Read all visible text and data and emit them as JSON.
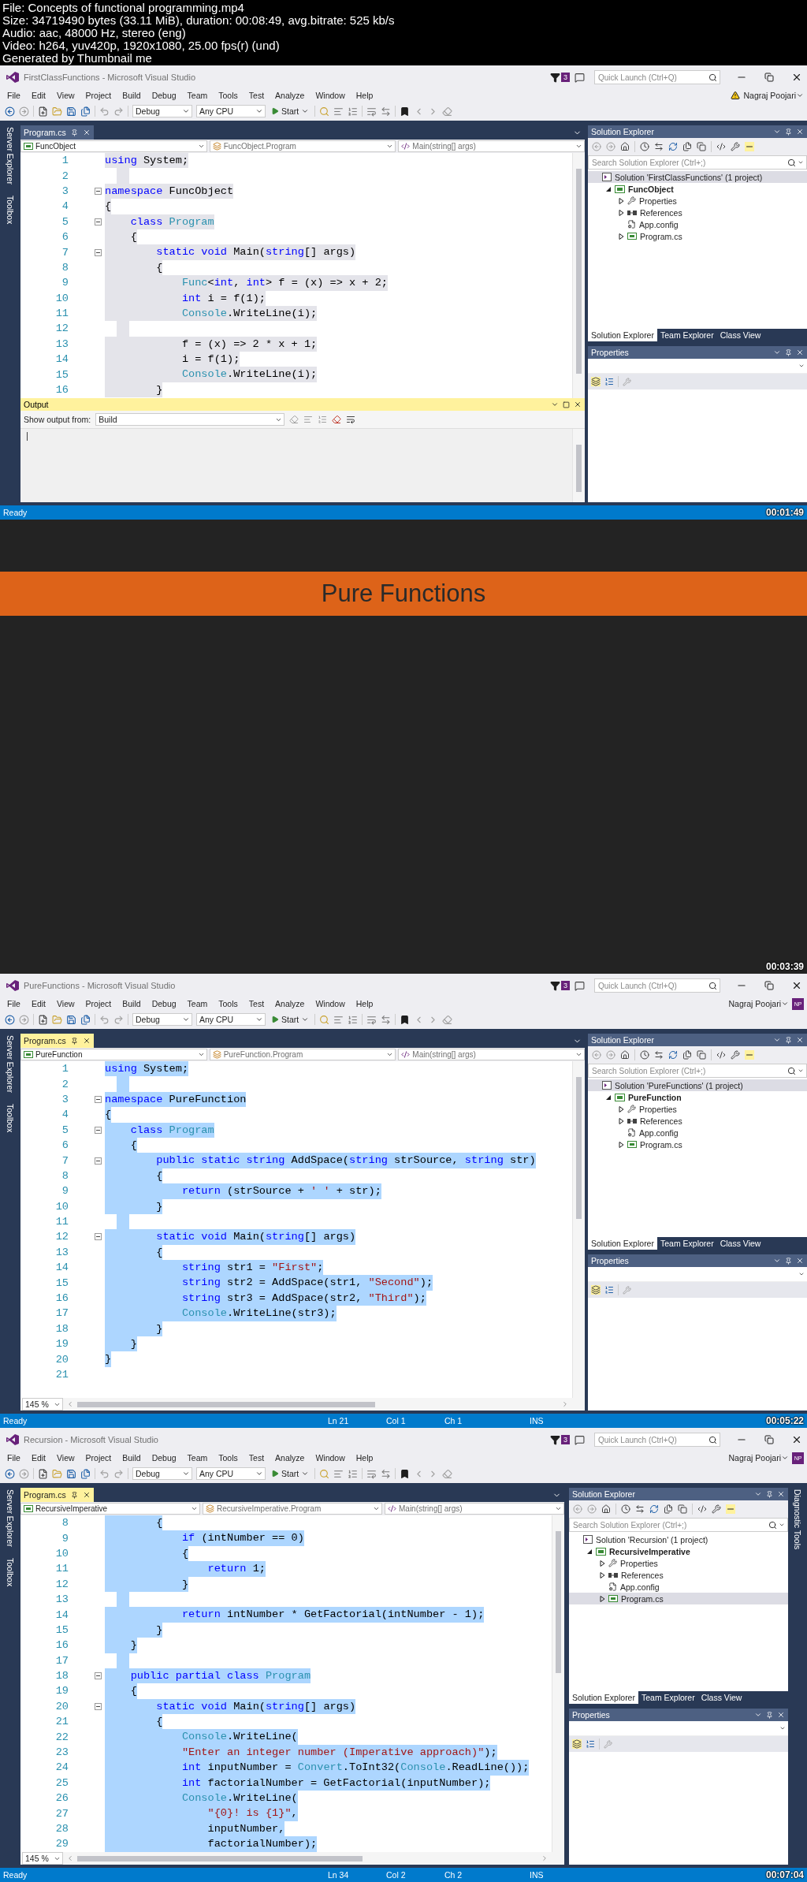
{
  "file_info": [
    "File: Concepts of functional programming.mp4",
    "Size: 34719490 bytes (33.11 MiB), duration: 00:08:49, avg.bitrate: 525 kb/s",
    "Audio: aac, 48000 Hz, stereo (eng)",
    "Video: h264, yuv420p, 1920x1080, 25.00 fps(r) (und)",
    "Generated by Thumbnail me"
  ],
  "frames": [
    {
      "kind": "ide",
      "window_title": "FirstClassFunctions - Microsoft Visual Studio",
      "notification_count": "3",
      "quick_launch": {
        "placeholder": "Quick Launch (Ctrl+Q)"
      },
      "menu": [
        "File",
        "Edit",
        "View",
        "Project",
        "Build",
        "Debug",
        "Team",
        "Tools",
        "Test",
        "Analyze",
        "Window",
        "Help"
      ],
      "user": {
        "name": "Nagraj Poojari",
        "warning": true
      },
      "toolbar": {
        "configuration": "Debug",
        "platform": "Any CPU",
        "start": "Start"
      },
      "left_side_tabs": [
        "Server Explorer",
        "Toolbox"
      ],
      "document_tab": {
        "label": "Program.cs",
        "active": false
      },
      "navigation": [
        "FuncObject",
        "FuncObject.Program",
        "Main(string[] args)"
      ],
      "code_lines": [
        {
          "number": "1",
          "fold": false,
          "selected": true,
          "tokens": [
            {
              "kind": "kw",
              "text": "using"
            },
            {
              "kind": "text",
              "text": " System;"
            }
          ]
        },
        {
          "number": "2",
          "fold": false,
          "selected": true
        },
        {
          "number": "3",
          "fold": true,
          "selected": true,
          "tokens": [
            {
              "kind": "kw",
              "text": "namespace"
            },
            {
              "kind": "text",
              "text": " FuncObject"
            }
          ]
        },
        {
          "number": "4",
          "fold": false,
          "selected": true,
          "tokens": [
            {
              "kind": "text",
              "text": "{"
            }
          ]
        },
        {
          "number": "5",
          "fold": true,
          "selected": true,
          "tokens": [
            {
              "kind": "kw",
              "text": "    class "
            },
            {
              "kind": "type",
              "text": "Program"
            }
          ]
        },
        {
          "number": "6",
          "fold": false,
          "selected": true,
          "tokens": [
            {
              "kind": "text",
              "text": "    {"
            }
          ]
        },
        {
          "number": "7",
          "fold": true,
          "selected": true,
          "tokens": [
            {
              "kind": "kw",
              "text": "        static void"
            },
            {
              "kind": "text",
              "text": " Main("
            },
            {
              "kind": "kw",
              "text": "string"
            },
            {
              "kind": "text",
              "text": "[] args)"
            }
          ]
        },
        {
          "number": "8",
          "fold": false,
          "selected": true,
          "tokens": [
            {
              "kind": "text",
              "text": "        {"
            }
          ]
        },
        {
          "number": "9",
          "fold": false,
          "selected": true,
          "tokens": [
            {
              "kind": "type",
              "text": "            Func"
            },
            {
              "kind": "text",
              "text": "<"
            },
            {
              "kind": "kw",
              "text": "int"
            },
            {
              "kind": "text",
              "text": ", "
            },
            {
              "kind": "kw",
              "text": "int"
            },
            {
              "kind": "text",
              "text": "> f = (x) => x + 2;"
            }
          ]
        },
        {
          "number": "10",
          "fold": false,
          "selected": true,
          "tokens": [
            {
              "kind": "kw",
              "text": "            int"
            },
            {
              "kind": "text",
              "text": " i = f(1);"
            }
          ]
        },
        {
          "number": "11",
          "fold": false,
          "selected": true,
          "tokens": [
            {
              "kind": "type",
              "text": "            Console"
            },
            {
              "kind": "text",
              "text": ".WriteLine(i);"
            }
          ]
        },
        {
          "number": "12",
          "fold": false,
          "selected": true
        },
        {
          "number": "13",
          "fold": false,
          "selected": true,
          "tokens": [
            {
              "kind": "text",
              "text": "            f = (x) => 2 * x + 1;"
            }
          ]
        },
        {
          "number": "14",
          "fold": false,
          "selected": true,
          "tokens": [
            {
              "kind": "text",
              "text": "            i = f(1);"
            }
          ]
        },
        {
          "number": "15",
          "fold": false,
          "selected": true,
          "tokens": [
            {
              "kind": "type",
              "text": "            Console"
            },
            {
              "kind": "text",
              "text": ".WriteLine(i);"
            }
          ]
        },
        {
          "number": "16",
          "fold": false,
          "selected": true,
          "tokens": [
            {
              "kind": "text",
              "text": "        }"
            }
          ]
        }
      ],
      "output": {
        "title": "Output",
        "label": "Show output from:",
        "source": "Build"
      },
      "solution_explorer": {
        "title": "Solution Explorer",
        "search_placeholder": "Search Solution Explorer (Ctrl+;)",
        "tree": [
          {
            "label": "Solution 'FirstClassFunctions' (1 project)",
            "kind": "solution",
            "selected": true,
            "children": [
              {
                "label": "FuncObject",
                "kind": "project",
                "selected": false,
                "expanded": true,
                "children": [
                  {
                    "label": "Properties",
                    "kind": "folder",
                    "selected": false,
                    "expanded": false
                  },
                  {
                    "label": "References",
                    "kind": "references",
                    "selected": false,
                    "expanded": false
                  },
                  {
                    "label": "App.config",
                    "kind": "config",
                    "selected": false
                  },
                  {
                    "label": "Program.cs",
                    "kind": "code",
                    "selected": false,
                    "expanded": false
                  }
                ]
              }
            ]
          }
        ]
      },
      "panel_tabs": [
        {
          "label": "Solution Explorer",
          "selected": true
        },
        {
          "label": "Team Explorer",
          "selected": false
        },
        {
          "label": "Class View",
          "selected": false
        }
      ],
      "properties": {
        "title": "Properties"
      },
      "status": {
        "text": "Ready"
      },
      "timestamp": "00:01:49"
    },
    {
      "kind": "banner",
      "title": "Pure Functions",
      "timestamp": "00:03:39"
    },
    {
      "kind": "ide",
      "window_title": "PureFunctions - Microsoft Visual Studio",
      "notification_count": "3",
      "quick_launch": {
        "placeholder": "Quick Launch (Ctrl+Q)"
      },
      "menu": [
        "File",
        "Edit",
        "View",
        "Project",
        "Build",
        "Debug",
        "Team",
        "Tools",
        "Test",
        "Analyze",
        "Window",
        "Help"
      ],
      "user": {
        "name": "Nagraj Poojari",
        "warning": false,
        "initials": "NP"
      },
      "toolbar": {
        "configuration": "Debug",
        "platform": "Any CPU",
        "start": "Start"
      },
      "left_side_tabs": [
        "Server Explorer",
        "Toolbox"
      ],
      "document_tab": {
        "label": "Program.cs",
        "active": true
      },
      "navigation": [
        "PureFunction",
        "PureFunction.Program",
        "Main(string[] args)"
      ],
      "code_lines": [
        {
          "number": "1",
          "fold": false,
          "selected": true,
          "tokens": [
            {
              "kind": "kw",
              "text": "using"
            },
            {
              "kind": "text",
              "text": " System;"
            }
          ]
        },
        {
          "number": "2",
          "fold": false,
          "selected": true
        },
        {
          "number": "3",
          "fold": true,
          "selected": true,
          "tokens": [
            {
              "kind": "kw",
              "text": "namespace"
            },
            {
              "kind": "text",
              "text": " PureFunction"
            }
          ]
        },
        {
          "number": "4",
          "fold": false,
          "selected": true,
          "tokens": [
            {
              "kind": "text",
              "text": "{"
            }
          ]
        },
        {
          "number": "5",
          "fold": true,
          "selected": true,
          "tokens": [
            {
              "kind": "kw",
              "text": "    class "
            },
            {
              "kind": "type",
              "text": "Program"
            }
          ]
        },
        {
          "number": "6",
          "fold": false,
          "selected": true,
          "tokens": [
            {
              "kind": "text",
              "text": "    {"
            }
          ]
        },
        {
          "number": "7",
          "fold": true,
          "selected": true,
          "tokens": [
            {
              "kind": "kw",
              "text": "        public static string"
            },
            {
              "kind": "text",
              "text": " AddSpace("
            },
            {
              "kind": "kw",
              "text": "string"
            },
            {
              "kind": "text",
              "text": " strSource, "
            },
            {
              "kind": "kw",
              "text": "string"
            },
            {
              "kind": "text",
              "text": " str)"
            }
          ]
        },
        {
          "number": "8",
          "fold": false,
          "selected": true,
          "tokens": [
            {
              "kind": "text",
              "text": "        {"
            }
          ]
        },
        {
          "number": "9",
          "fold": false,
          "selected": true,
          "tokens": [
            {
              "kind": "kw",
              "text": "            return"
            },
            {
              "kind": "text",
              "text": " (strSource + "
            },
            {
              "kind": "str",
              "text": "' '"
            },
            {
              "kind": "text",
              "text": " + str);"
            }
          ]
        },
        {
          "number": "10",
          "fold": false,
          "selected": true,
          "tokens": [
            {
              "kind": "text",
              "text": "        }"
            }
          ]
        },
        {
          "number": "11",
          "fold": false,
          "selected": true
        },
        {
          "number": "12",
          "fold": true,
          "selected": true,
          "tokens": [
            {
              "kind": "kw",
              "text": "        static void"
            },
            {
              "kind": "text",
              "text": " Main("
            },
            {
              "kind": "kw",
              "text": "string"
            },
            {
              "kind": "text",
              "text": "[] args)"
            }
          ]
        },
        {
          "number": "13",
          "fold": false,
          "selected": true,
          "tokens": [
            {
              "kind": "text",
              "text": "        {"
            }
          ]
        },
        {
          "number": "14",
          "fold": false,
          "selected": true,
          "tokens": [
            {
              "kind": "kw",
              "text": "            string"
            },
            {
              "kind": "text",
              "text": " str1 = "
            },
            {
              "kind": "str",
              "text": "\"First\""
            },
            {
              "kind": "text",
              "text": ";"
            }
          ]
        },
        {
          "number": "15",
          "fold": false,
          "selected": true,
          "tokens": [
            {
              "kind": "kw",
              "text": "            string"
            },
            {
              "kind": "text",
              "text": " str2 = AddSpace(str1, "
            },
            {
              "kind": "str",
              "text": "\"Second\""
            },
            {
              "kind": "text",
              "text": ");"
            }
          ]
        },
        {
          "number": "16",
          "fold": false,
          "selected": true,
          "tokens": [
            {
              "kind": "kw",
              "text": "            string"
            },
            {
              "kind": "text",
              "text": " str3 = AddSpace(str2, "
            },
            {
              "kind": "str",
              "text": "\"Third\""
            },
            {
              "kind": "text",
              "text": ");"
            }
          ]
        },
        {
          "number": "17",
          "fold": false,
          "selected": true,
          "tokens": [
            {
              "kind": "type",
              "text": "            Console"
            },
            {
              "kind": "text",
              "text": ".WriteLine(str3);"
            }
          ]
        },
        {
          "number": "18",
          "fold": false,
          "selected": true,
          "tokens": [
            {
              "kind": "text",
              "text": "        }"
            }
          ]
        },
        {
          "number": "19",
          "fold": false,
          "selected": true,
          "tokens": [
            {
              "kind": "text",
              "text": "    }"
            }
          ]
        },
        {
          "number": "20",
          "fold": false,
          "selected": true,
          "tokens": [
            {
              "kind": "text",
              "text": "}"
            }
          ]
        },
        {
          "number": "21",
          "fold": false,
          "selected": false
        }
      ],
      "zoom_level": "145 %",
      "solution_explorer": {
        "title": "Solution Explorer",
        "search_placeholder": "Search Solution Explorer (Ctrl+;)",
        "tree": [
          {
            "label": "Solution 'PureFunctions' (1 project)",
            "kind": "solution",
            "selected": true,
            "children": [
              {
                "label": "PureFunction",
                "kind": "project",
                "selected": false,
                "expanded": true,
                "children": [
                  {
                    "label": "Properties",
                    "kind": "folder",
                    "selected": false,
                    "expanded": false
                  },
                  {
                    "label": "References",
                    "kind": "references",
                    "selected": false,
                    "expanded": false
                  },
                  {
                    "label": "App.config",
                    "kind": "config",
                    "selected": false
                  },
                  {
                    "label": "Program.cs",
                    "kind": "code",
                    "selected": false,
                    "expanded": false
                  }
                ]
              }
            ]
          }
        ]
      },
      "panel_tabs": [
        {
          "label": "Solution Explorer",
          "selected": true
        },
        {
          "label": "Team Explorer",
          "selected": false
        },
        {
          "label": "Class View",
          "selected": false
        }
      ],
      "properties": {
        "title": "Properties"
      },
      "status": {
        "text": "Ready",
        "items": [
          "Ln 21",
          "Col 1",
          "Ch 1",
          "INS"
        ]
      },
      "timestamp": "00:05:22"
    },
    {
      "kind": "ide",
      "window_title": "Recursion - Microsoft Visual Studio",
      "notification_count": "3",
      "quick_launch": {
        "placeholder": "Quick Launch (Ctrl+Q)"
      },
      "menu": [
        "File",
        "Edit",
        "View",
        "Project",
        "Build",
        "Debug",
        "Team",
        "Tools",
        "Test",
        "Analyze",
        "Window",
        "Help"
      ],
      "user": {
        "name": "Nagraj Poojari",
        "warning": false,
        "initials": "NP"
      },
      "toolbar": {
        "configuration": "Debug",
        "platform": "Any CPU",
        "start": "Start"
      },
      "left_side_tabs": [
        "Server Explorer",
        "Toolbox"
      ],
      "right_side_tabs": [
        "Diagnostic Tools"
      ],
      "document_tab": {
        "label": "Program.cs",
        "active": true
      },
      "navigation": [
        "RecursiveImperative",
        "RecursiveImperative.Program",
        "Main(string[] args)"
      ],
      "code_lines": [
        {
          "number": "8",
          "fold": false,
          "selected": true,
          "tokens": [
            {
              "kind": "text",
              "text": "        {"
            }
          ]
        },
        {
          "number": "9",
          "fold": false,
          "selected": true,
          "tokens": [
            {
              "kind": "kw",
              "text": "            if"
            },
            {
              "kind": "text",
              "text": " (intNumber == 0)"
            }
          ]
        },
        {
          "number": "10",
          "fold": false,
          "selected": true,
          "tokens": [
            {
              "kind": "text",
              "text": "            {"
            }
          ]
        },
        {
          "number": "11",
          "fold": false,
          "selected": true,
          "tokens": [
            {
              "kind": "kw",
              "text": "                return"
            },
            {
              "kind": "text",
              "text": " 1;"
            }
          ]
        },
        {
          "number": "12",
          "fold": false,
          "selected": true,
          "tokens": [
            {
              "kind": "text",
              "text": "            }"
            }
          ]
        },
        {
          "number": "13",
          "fold": false,
          "selected": true
        },
        {
          "number": "14",
          "fold": false,
          "selected": true,
          "tokens": [
            {
              "kind": "kw",
              "text": "            return"
            },
            {
              "kind": "text",
              "text": " intNumber * GetFactorial(intNumber - 1);"
            }
          ]
        },
        {
          "number": "15",
          "fold": false,
          "selected": true,
          "tokens": [
            {
              "kind": "text",
              "text": "        }"
            }
          ]
        },
        {
          "number": "16",
          "fold": false,
          "selected": true,
          "tokens": [
            {
              "kind": "text",
              "text": "    }"
            }
          ]
        },
        {
          "number": "17",
          "fold": false,
          "selected": true
        },
        {
          "number": "18",
          "fold": true,
          "selected": true,
          "tokens": [
            {
              "kind": "kw",
              "text": "    public partial class "
            },
            {
              "kind": "type",
              "text": "Program"
            }
          ]
        },
        {
          "number": "19",
          "fold": false,
          "selected": true,
          "tokens": [
            {
              "kind": "text",
              "text": "    {"
            }
          ]
        },
        {
          "number": "20",
          "fold": true,
          "selected": true,
          "tokens": [
            {
              "kind": "kw",
              "text": "        static void"
            },
            {
              "kind": "text",
              "text": " Main("
            },
            {
              "kind": "kw",
              "text": "string"
            },
            {
              "kind": "text",
              "text": "[] args)"
            }
          ]
        },
        {
          "number": "21",
          "fold": false,
          "selected": true,
          "tokens": [
            {
              "kind": "text",
              "text": "        {"
            }
          ]
        },
        {
          "number": "22",
          "fold": false,
          "selected": true,
          "tokens": [
            {
              "kind": "type",
              "text": "            Console"
            },
            {
              "kind": "text",
              "text": ".WriteLine("
            }
          ]
        },
        {
          "number": "23",
          "fold": false,
          "selected": true,
          "tokens": [
            {
              "kind": "str",
              "text": "            \"Enter an integer number (Imperative approach)\""
            },
            {
              "kind": "text",
              "text": ");"
            }
          ]
        },
        {
          "number": "24",
          "fold": false,
          "selected": true,
          "tokens": [
            {
              "kind": "kw",
              "text": "            int"
            },
            {
              "kind": "text",
              "text": " inputNumber = "
            },
            {
              "kind": "type",
              "text": "Convert"
            },
            {
              "kind": "text",
              "text": ".ToInt32("
            },
            {
              "kind": "type",
              "text": "Console"
            },
            {
              "kind": "text",
              "text": ".ReadLine());"
            }
          ]
        },
        {
          "number": "25",
          "fold": false,
          "selected": true,
          "tokens": [
            {
              "kind": "kw",
              "text": "            int"
            },
            {
              "kind": "text",
              "text": " factorialNumber = GetFactorial(inputNumber);"
            }
          ]
        },
        {
          "number": "26",
          "fold": false,
          "selected": true,
          "tokens": [
            {
              "kind": "type",
              "text": "            Console"
            },
            {
              "kind": "text",
              "text": ".WriteLine("
            }
          ]
        },
        {
          "number": "27",
          "fold": false,
          "selected": true,
          "tokens": [
            {
              "kind": "str",
              "text": "                \"{0}! is {1}\""
            },
            {
              "kind": "text",
              "text": ","
            }
          ]
        },
        {
          "number": "28",
          "fold": false,
          "selected": true,
          "tokens": [
            {
              "kind": "text",
              "text": "                inputNumber,"
            }
          ]
        },
        {
          "number": "29",
          "fold": false,
          "selected": true,
          "tokens": [
            {
              "kind": "text",
              "text": "                factorialNumber);"
            }
          ]
        }
      ],
      "zoom_level": "145 %",
      "solution_explorer": {
        "title": "Solution Explorer",
        "search_placeholder": "Search Solution Explorer (Ctrl+;)",
        "tree": [
          {
            "label": "Solution 'Recursion' (1 project)",
            "kind": "solution",
            "selected": false,
            "children": [
              {
                "label": "RecursiveImperative",
                "kind": "project",
                "selected": false,
                "expanded": true,
                "children": [
                  {
                    "label": "Properties",
                    "kind": "folder",
                    "selected": false,
                    "expanded": false
                  },
                  {
                    "label": "References",
                    "kind": "references",
                    "selected": false,
                    "expanded": false
                  },
                  {
                    "label": "App.config",
                    "kind": "config",
                    "selected": false
                  },
                  {
                    "label": "Program.cs",
                    "kind": "code",
                    "selected": true,
                    "expanded": false
                  }
                ]
              }
            ]
          }
        ]
      },
      "panel_tabs": [
        {
          "label": "Solution Explorer",
          "selected": true
        },
        {
          "label": "Team Explorer",
          "selected": false
        },
        {
          "label": "Class View",
          "selected": false
        }
      ],
      "properties": {
        "title": "Properties"
      },
      "status": {
        "text": "Ready",
        "items": [
          "Ln 34",
          "Col 2",
          "Ch 2",
          "INS"
        ]
      },
      "timestamp": "00:07:04"
    }
  ]
}
